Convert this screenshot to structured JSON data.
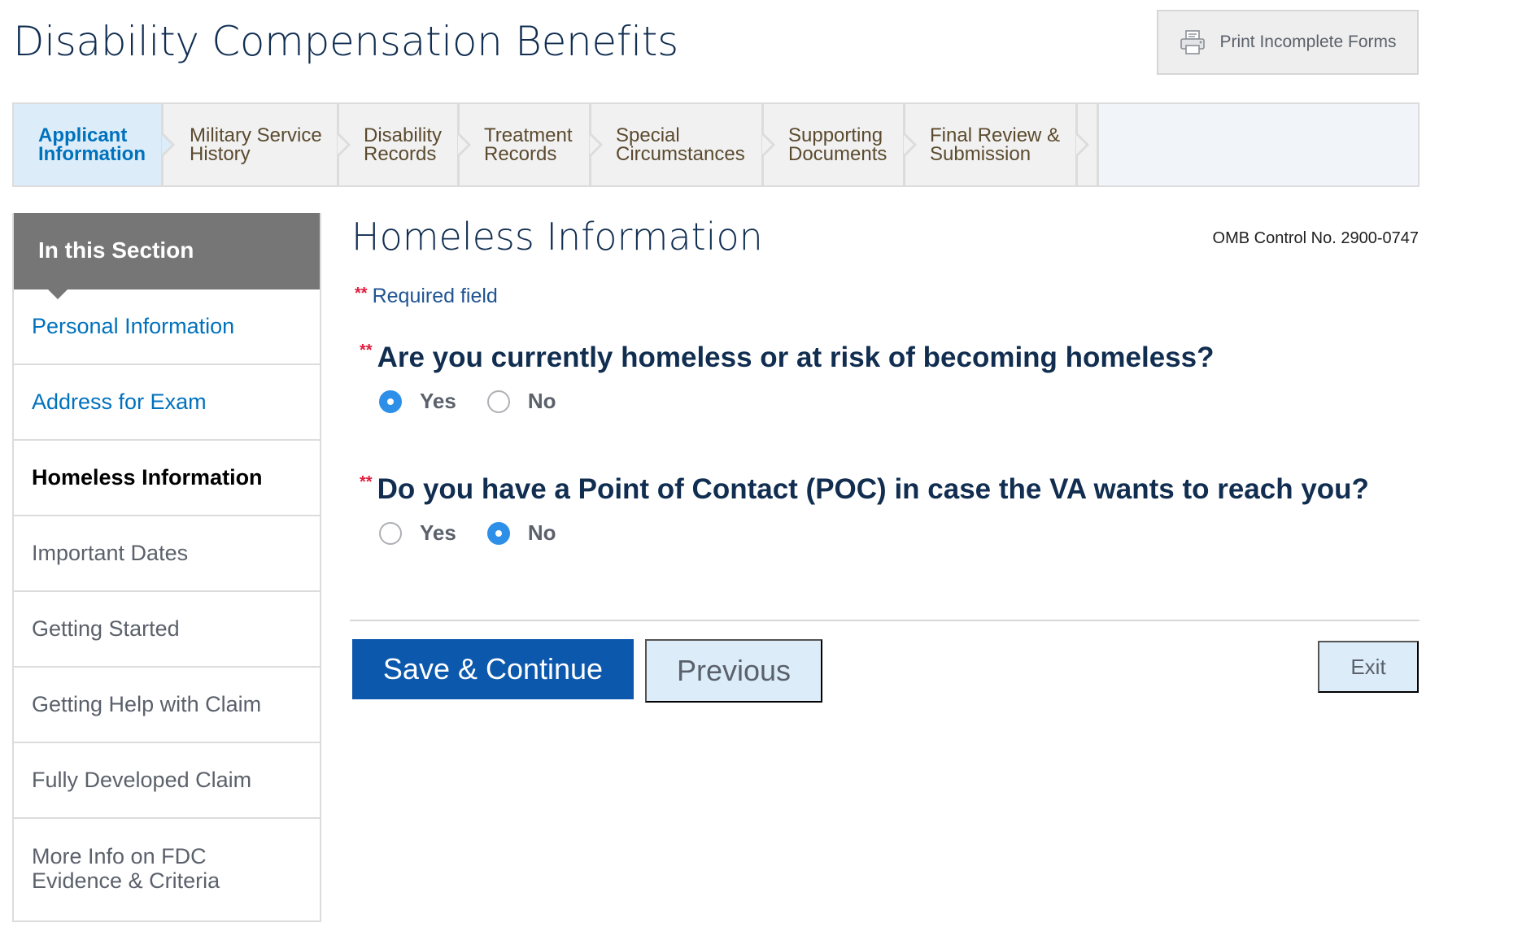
{
  "header": {
    "title": "Disability Compensation Benefits",
    "print_label": "Print Incomplete Forms",
    "print_icon": "printer-icon"
  },
  "steps": [
    {
      "line1": "Applicant",
      "line2": "Information",
      "active": true
    },
    {
      "line1": "Military Service",
      "line2": "History",
      "active": false
    },
    {
      "line1": "Disability",
      "line2": "Records",
      "active": false
    },
    {
      "line1": "Treatment",
      "line2": "Records",
      "active": false
    },
    {
      "line1": "Special",
      "line2": "Circumstances",
      "active": false
    },
    {
      "line1": "Supporting",
      "line2": "Documents",
      "active": false
    },
    {
      "line1": "Final Review &",
      "line2": "Submission",
      "active": false
    }
  ],
  "sidebar": {
    "heading": "In this Section",
    "items": [
      {
        "label": "Personal Information",
        "state": "link"
      },
      {
        "label": "Address for Exam",
        "state": "link"
      },
      {
        "label": "Homeless Information",
        "state": "current"
      },
      {
        "label": "Important Dates",
        "state": "normal"
      },
      {
        "label": "Getting Started",
        "state": "normal"
      },
      {
        "label": "Getting Help with Claim",
        "state": "normal"
      },
      {
        "label": "Fully Developed Claim",
        "state": "normal"
      },
      {
        "label": "More Info on FDC Evidence & Criteria",
        "line1": "More Info on FDC",
        "line2": "Evidence & Criteria",
        "state": "normal"
      }
    ]
  },
  "main": {
    "title": "Homeless Information",
    "omb": "OMB Control No. 2900-0747",
    "required_marker": "**",
    "required_text": "Required field",
    "questions": [
      {
        "text": "Are you currently homeless or at risk of becoming homeless?",
        "options": [
          "Yes",
          "No"
        ],
        "selected": "Yes"
      },
      {
        "text": "Do you have a Point of Contact (POC) in case the VA wants to reach you?",
        "options": [
          "Yes",
          "No"
        ],
        "selected": "No"
      }
    ]
  },
  "actions": {
    "save": "Save & Continue",
    "previous": "Previous",
    "exit": "Exit"
  },
  "colors": {
    "primary": "#0b58ad",
    "link": "#0071bc",
    "heading": "#112e51",
    "required": "#e31c3d",
    "radio_selected": "#2e8fe8"
  }
}
